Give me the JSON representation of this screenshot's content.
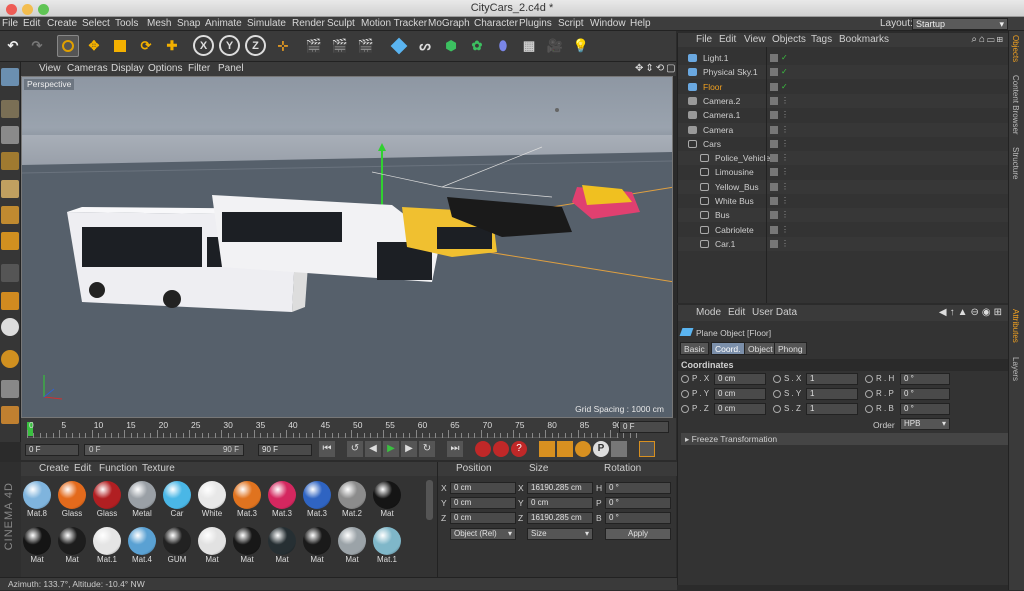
{
  "window": {
    "title": "CityCars_2.c4d *"
  },
  "menu": [
    "File",
    "Edit",
    "Create",
    "Select",
    "Tools",
    "Mesh",
    "Snap",
    "Animate",
    "Simulate",
    "Render",
    "Sculpt",
    "Motion Tracker",
    "MoGraph",
    "Character",
    "Plugins",
    "Script",
    "Window",
    "Help"
  ],
  "layout": {
    "label": "Layout:",
    "value": "Startup"
  },
  "toolbar": {
    "x": "X",
    "y": "Y",
    "z": "Z"
  },
  "viewport": {
    "menu": [
      "View",
      "Cameras",
      "Display",
      "Options",
      "Filter",
      "Panel"
    ],
    "label": "Perspective",
    "grid_spacing": "Grid Spacing : 1000 cm"
  },
  "timeline": {
    "ticks": [
      "0",
      "5",
      "10",
      "15",
      "20",
      "25",
      "30",
      "35",
      "40",
      "45",
      "50",
      "55",
      "60",
      "65",
      "70",
      "75",
      "80",
      "85",
      "90"
    ],
    "end_frame": "0 F",
    "start_field": "0 F",
    "range_left": "0 F",
    "range_right": "90 F",
    "end_field": "90 F"
  },
  "materials": {
    "menu": [
      "Create",
      "Edit",
      "Function",
      "Texture"
    ],
    "items": [
      {
        "name": "Mat.8",
        "color": "#7fb4dd"
      },
      {
        "name": "Glass",
        "color": "#e36a1c"
      },
      {
        "name": "Glass",
        "color": "#b11f22"
      },
      {
        "name": "Metal",
        "color": "#9aa0a6"
      },
      {
        "name": "Car",
        "color": "#4ab7e6"
      },
      {
        "name": "White",
        "color": "#e8e8e8"
      },
      {
        "name": "Mat.3",
        "color": "#e0731f"
      },
      {
        "name": "Mat.3",
        "color": "#d4275f"
      },
      {
        "name": "Mat.3",
        "color": "#2f64c2"
      },
      {
        "name": "Mat.2",
        "color": "#8c8c8c"
      },
      {
        "name": "Mat",
        "color": "#151515"
      },
      {
        "name": "Mat",
        "color": "#151515"
      },
      {
        "name": "Mat",
        "color": "#1d1d1d"
      },
      {
        "name": "Mat.1",
        "color": "#e5e5e5"
      },
      {
        "name": "Mat.4",
        "color": "#5aa1d3"
      },
      {
        "name": "GUM",
        "color": "#222222"
      },
      {
        "name": "Mat",
        "color": "#e2e2e2"
      },
      {
        "name": "Mat",
        "color": "#181818"
      },
      {
        "name": "Mat",
        "color": "#262f33"
      },
      {
        "name": "Mat",
        "color": "#1a1a1a"
      },
      {
        "name": "Mat",
        "color": "#9ba3a8"
      },
      {
        "name": "Mat.1",
        "color": "#7fb7c9"
      }
    ],
    "brand": "CINEMA 4D"
  },
  "coords": {
    "headers": {
      "position": "Position",
      "size": "Size",
      "rotation": "Rotation"
    },
    "rows": [
      {
        "axis": "X",
        "pos": "0 cm",
        "size_axis": "X",
        "size": "16190.285 cm",
        "rot_axis": "H",
        "rot": "0 °"
      },
      {
        "axis": "Y",
        "pos": "0 cm",
        "size_axis": "Y",
        "size": "0 cm",
        "rot_axis": "P",
        "rot": "0 °"
      },
      {
        "axis": "Z",
        "pos": "0 cm",
        "size_axis": "Z",
        "size": "16190.285 cm",
        "rot_axis": "B",
        "rot": "0 °"
      }
    ],
    "mode": "Object (Rel)",
    "size_mode": "Size",
    "apply": "Apply"
  },
  "objects": {
    "menu": [
      "File",
      "Edit",
      "View",
      "Objects",
      "Tags",
      "Bookmarks"
    ],
    "items": [
      {
        "name": "Light.1",
        "indent": 0
      },
      {
        "name": "Physical Sky.1",
        "indent": 0
      },
      {
        "name": "Floor",
        "indent": 0,
        "selected": true
      },
      {
        "name": "Camera.2",
        "indent": 0
      },
      {
        "name": "Camera.1",
        "indent": 0
      },
      {
        "name": "Camera",
        "indent": 0
      },
      {
        "name": "Cars",
        "indent": 0
      },
      {
        "name": "Police_Vehicle",
        "indent": 1
      },
      {
        "name": "Limousine",
        "indent": 1
      },
      {
        "name": "Yellow_Bus",
        "indent": 1
      },
      {
        "name": "White Bus",
        "indent": 1
      },
      {
        "name": "Bus",
        "indent": 1
      },
      {
        "name": "Cabriolete",
        "indent": 1
      },
      {
        "name": "Car.1",
        "indent": 1
      }
    ]
  },
  "attributes": {
    "menu": [
      "Mode",
      "Edit",
      "User Data"
    ],
    "object_title": "Plane Object [Floor]",
    "tabs": [
      "Basic",
      "Coord.",
      "Object",
      "Phong"
    ],
    "section": "Coordinates",
    "rows": [
      {
        "p_label": "P . X",
        "p": "0 cm",
        "s_label": "S . X",
        "s": "1",
        "r_label": "R . H",
        "r": "0 °"
      },
      {
        "p_label": "P . Y",
        "p": "0 cm",
        "s_label": "S . Y",
        "s": "1",
        "r_label": "R . P",
        "r": "0 °"
      },
      {
        "p_label": "P . Z",
        "p": "0 cm",
        "s_label": "S . Z",
        "s": "1",
        "r_label": "R . B",
        "r": "0 °"
      }
    ],
    "order_label": "Order",
    "order_value": "HPB",
    "freeze": "Freeze Transformation"
  },
  "side_tabs": {
    "objects": "Objects",
    "content_browser": "Content Browser",
    "structure": "Structure",
    "attributes": "Attributes",
    "layers": "Layers"
  },
  "status": "Azimuth: 133.7°, Altitude: -10.4°  NW"
}
